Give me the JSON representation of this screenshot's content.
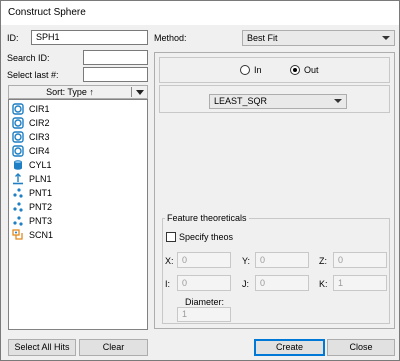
{
  "window": {
    "title": "Construct Sphere"
  },
  "id": {
    "label": "ID:",
    "value": "SPH1"
  },
  "search_id": {
    "label": "Search ID:",
    "value": ""
  },
  "select_last": {
    "label": "Select last #:",
    "value": ""
  },
  "method": {
    "label": "Method:",
    "value": "Best Fit"
  },
  "sort": {
    "label": "Sort: Type ↑"
  },
  "features": [
    {
      "name": "CIR1",
      "icon": "circle-icon"
    },
    {
      "name": "CIR2",
      "icon": "circle-icon"
    },
    {
      "name": "CIR3",
      "icon": "circle-icon"
    },
    {
      "name": "CIR4",
      "icon": "circle-icon"
    },
    {
      "name": "CYL1",
      "icon": "cylinder-icon"
    },
    {
      "name": "PLN1",
      "icon": "plane-icon"
    },
    {
      "name": "PNT1",
      "icon": "point-icon"
    },
    {
      "name": "PNT2",
      "icon": "point-icon"
    },
    {
      "name": "PNT3",
      "icon": "point-icon"
    },
    {
      "name": "SCN1",
      "icon": "scan-icon"
    }
  ],
  "direction": {
    "in_label": "In",
    "out_label": "Out",
    "selected": "Out"
  },
  "fit_type": {
    "value": "LEAST_SQR"
  },
  "theoreticals": {
    "group_label": "Feature theoreticals",
    "specify_label": "Specify theos",
    "specify_checked": false,
    "x": {
      "label": "X:",
      "value": "0"
    },
    "y": {
      "label": "Y:",
      "value": "0"
    },
    "z": {
      "label": "Z:",
      "value": "0"
    },
    "i": {
      "label": "I:",
      "value": "0"
    },
    "j": {
      "label": "J:",
      "value": "0"
    },
    "k": {
      "label": "K:",
      "value": "1"
    },
    "diameter": {
      "label": "Diameter:",
      "value": "1"
    }
  },
  "buttons": {
    "select_all_hits": "Select All Hits",
    "clear": "Clear",
    "create": "Create",
    "close": "Close"
  },
  "colors": {
    "accent": "#0078d7",
    "icon_blue": "#1f7fc4",
    "icon_orange": "#e08a1e"
  }
}
